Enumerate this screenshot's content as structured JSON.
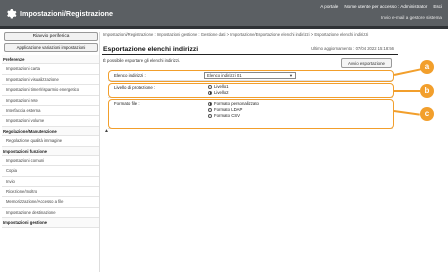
{
  "header": {
    "title": "Impostazioni/Registrazione",
    "nav": [
      "A portale",
      "Nome utente per accesso :  Administrator",
      "Esci"
    ],
    "subtitle": "Invio e-mail a gestore sistema"
  },
  "sidebar": {
    "buttons": [
      "Riavvio periferica",
      "Applicazione variazioni impostazioni"
    ],
    "items": [
      {
        "label": "Preferenze",
        "kind": "section"
      },
      {
        "label": "Impostazioni carta",
        "kind": "sub"
      },
      {
        "label": "Impostazioni visualizzazione",
        "kind": "sub"
      },
      {
        "label": "Impostazioni timer/risparmio energetico",
        "kind": "sub"
      },
      {
        "label": "Impostazioni rete",
        "kind": "sub"
      },
      {
        "label": "Interfaccia esterna",
        "kind": "sub"
      },
      {
        "label": "Impostazioni volume",
        "kind": "sub"
      },
      {
        "label": "Regolazione/Manutenzione",
        "kind": "section"
      },
      {
        "label": "Regolazione qualità immagine",
        "kind": "sub"
      },
      {
        "label": "Impostazioni funzione",
        "kind": "section"
      },
      {
        "label": "Impostazioni comuni",
        "kind": "sub"
      },
      {
        "label": "Copia",
        "kind": "sub"
      },
      {
        "label": "Invio",
        "kind": "sub"
      },
      {
        "label": "Ricezione/Inoltro",
        "kind": "sub"
      },
      {
        "label": "Memorizzazione/Accesso a file",
        "kind": "sub"
      },
      {
        "label": "Impostazione destinazione",
        "kind": "sub"
      },
      {
        "label": "Impostazioni gestione",
        "kind": "section"
      }
    ]
  },
  "main": {
    "breadcrumb": "Impostazioni/Registrazione : Impostazioni gestione : Gestione dati > Importazione/Esportazione elenchi indirizzi > Esportazione elenchi indirizzi",
    "title": "Esportazione elenchi indirizzi",
    "last_update": "Ultimo aggiornamento : 07/04 2022 15:18:56",
    "intro": "È possibile esportare gli elenchi indirizzi.",
    "start_button": "Avvio esportazione",
    "address_list_label": "Elenco indirizzi :",
    "address_list_value": "Elenco indirizzi 01",
    "protection_label": "Livello di protezione :",
    "protection_options": [
      "Livello1",
      "Livello2"
    ],
    "protection_selected": 1,
    "format_label": "Formato file :",
    "format_options": [
      "Formato personalizzato",
      "Formato LDAP",
      "Formato CSV"
    ],
    "format_selected": 0
  },
  "callouts": [
    "a",
    "b",
    "c"
  ],
  "colors": {
    "header": "#5b5f63",
    "callout": "#f29f2c"
  }
}
